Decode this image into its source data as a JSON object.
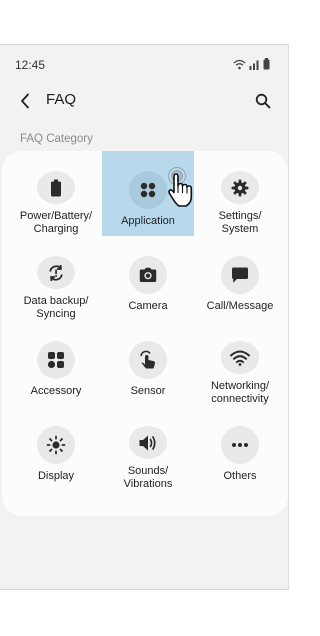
{
  "status_bar": {
    "time": "12:45",
    "icons": [
      "wifi-icon",
      "signal-icon",
      "battery-icon"
    ]
  },
  "app_bar": {
    "title": "FAQ",
    "back_icon": "back-arrow-icon",
    "search_icon": "search-icon"
  },
  "section": {
    "label": "FAQ Category"
  },
  "categories": [
    {
      "label": "Power/Battery/\nCharging",
      "icon": "battery-icon",
      "selected": false
    },
    {
      "label": "Application",
      "icon": "apps-icon",
      "selected": true
    },
    {
      "label": "Settings/\nSystem",
      "icon": "gear-icon",
      "selected": false
    },
    {
      "label": "Data backup/\nSyncing",
      "icon": "sync-icon",
      "selected": false
    },
    {
      "label": "Camera",
      "icon": "camera-icon",
      "selected": false
    },
    {
      "label": "Call/Message",
      "icon": "message-icon",
      "selected": false
    },
    {
      "label": "Accessory",
      "icon": "accessory-icon",
      "selected": false
    },
    {
      "label": "Sensor",
      "icon": "touch-icon",
      "selected": false
    },
    {
      "label": "Networking/\nconnectivity",
      "icon": "wifi-icon",
      "selected": false
    },
    {
      "label": "Display",
      "icon": "brightness-icon",
      "selected": false
    },
    {
      "label": "Sounds/\nVibrations",
      "icon": "volume-icon",
      "selected": false
    },
    {
      "label": "Others",
      "icon": "more-icon",
      "selected": false
    }
  ],
  "colors": {
    "highlight": "#b8d8ec",
    "icon": "#2b2b2b",
    "background": "#f2f2f2",
    "card": "#fcfcfc"
  }
}
